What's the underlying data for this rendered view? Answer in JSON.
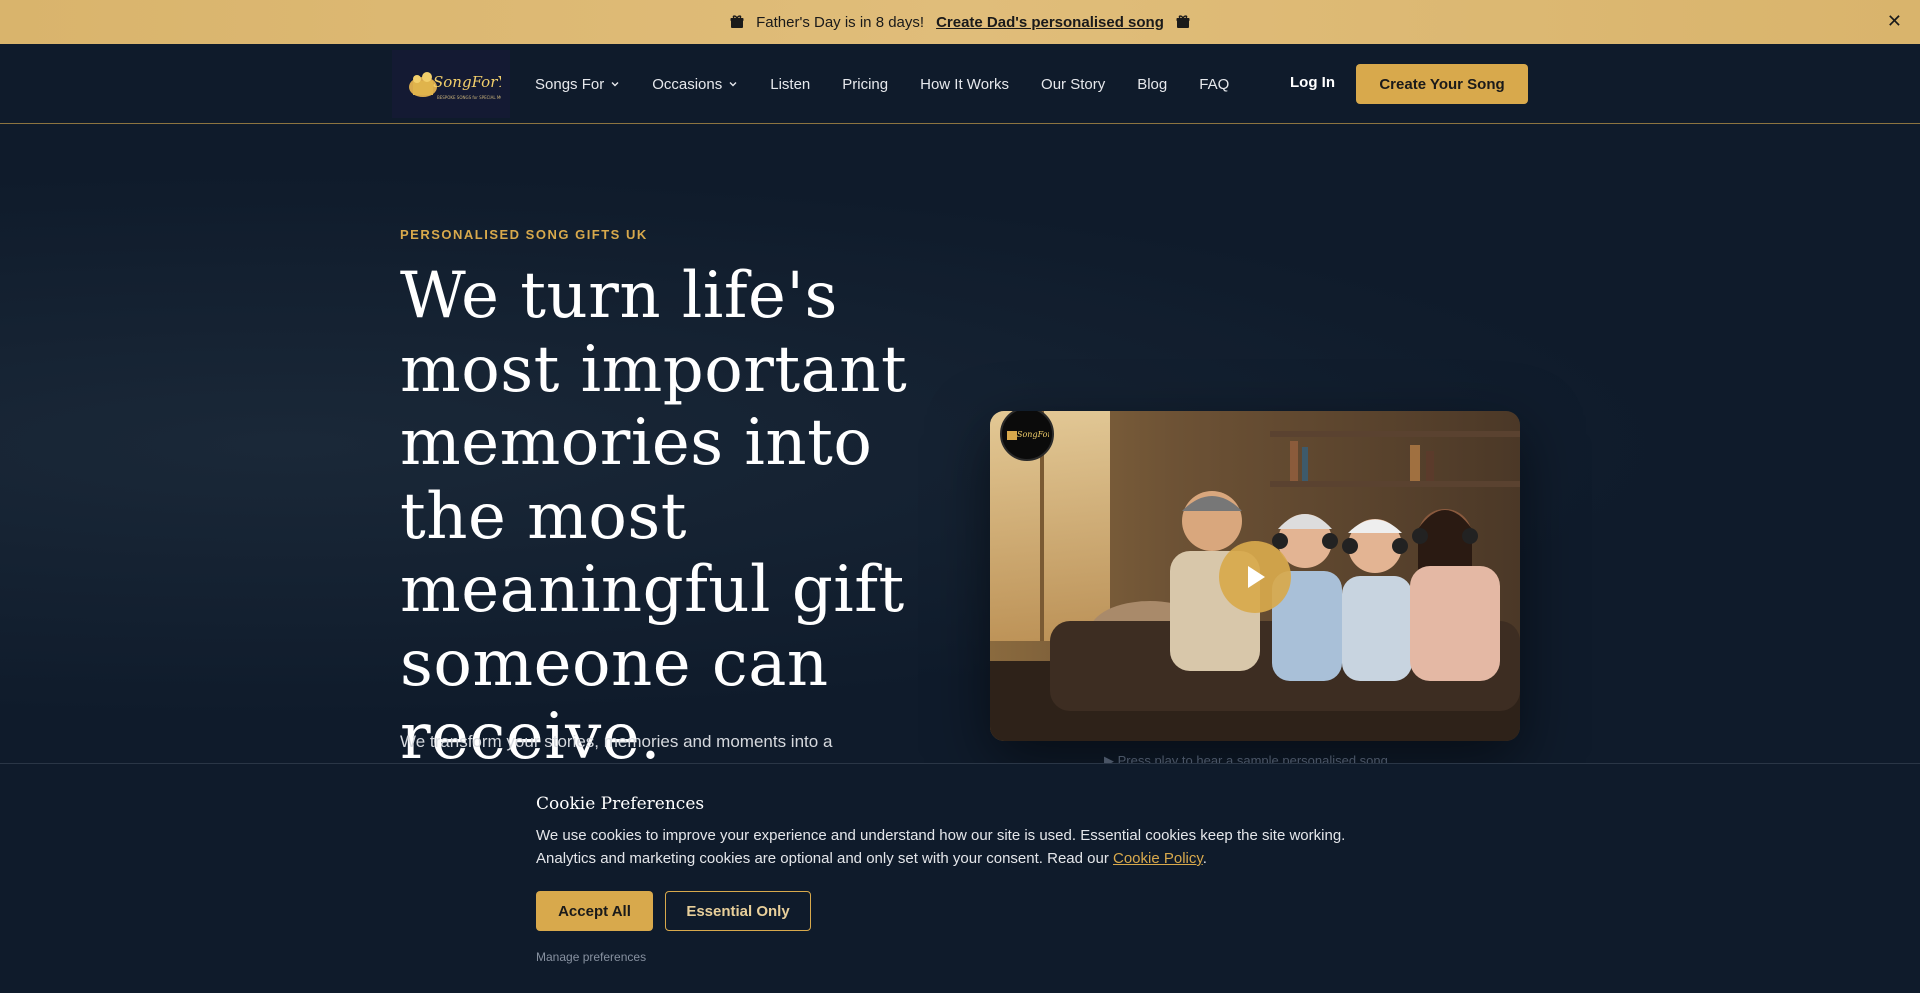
{
  "announcement": {
    "text": "Father's Day is in 8 days!",
    "link": "Create Dad's personalised song",
    "icon": "gift-icon",
    "close": "✕"
  },
  "nav": {
    "logo_alt": "SongForYou",
    "links": [
      "Songs For",
      "Occasions",
      "Listen",
      "Pricing",
      "How It Works",
      "Our Story",
      "Blog",
      "FAQ"
    ],
    "login": "Log In",
    "cta": "Create Your Song"
  },
  "hero": {
    "eyebrow": "PERSONALISED SONG GIFTS UK",
    "headline": "We turn life's most important memories into the most meaningful gift someone can receive.",
    "subtext": "We transform your stories, memories and moments into a",
    "video_caption": "▶ Press play to hear a sample personalised song"
  },
  "cookie": {
    "title": "Cookie Preferences",
    "text": "We use cookies to improve your experience and understand how our site is used. Essential cookies keep the site working. Analytics and marketing cookies are optional and only set with your consent. Read our",
    "policy_link": "Cookie Policy",
    "accept": "Accept All",
    "essential": "Essential Only",
    "manage": "Manage preferences"
  },
  "colors": {
    "accent": "#d8a94c",
    "background": "#0f1b2b",
    "announce_bar": "#dcb773"
  }
}
